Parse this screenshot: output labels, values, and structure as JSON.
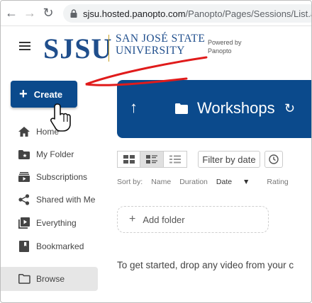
{
  "browser": {
    "url_host": "sjsu.hosted.panopto.com",
    "url_path": "/Panopto/Pages/Sessions/List.aspx#fold"
  },
  "header": {
    "logo_abbrev": "SJSU",
    "logo_line1": "SAN JOSÉ STATE",
    "logo_line2": "UNIVERSITY",
    "powered_line1": "Powered by",
    "powered_line2": "Panopto"
  },
  "sidebar": {
    "create_label": "Create",
    "items": [
      {
        "label": "Home",
        "icon": "home-icon"
      },
      {
        "label": "My Folder",
        "icon": "my-folder-icon"
      },
      {
        "label": "Subscriptions",
        "icon": "subscriptions-icon"
      },
      {
        "label": "Shared with Me",
        "icon": "share-icon"
      },
      {
        "label": "Everything",
        "icon": "everything-icon"
      },
      {
        "label": "Bookmarked",
        "icon": "bookmark-icon"
      },
      {
        "label": "Browse",
        "icon": "browse-folder-icon"
      }
    ]
  },
  "main": {
    "folder_title": "Workshops",
    "filter_label": "Filter by date",
    "sort": {
      "prefix": "Sort by:",
      "name": "Name",
      "duration": "Duration",
      "date": "Date",
      "rating": "Rating"
    },
    "add_folder_label": "Add folder",
    "hint_text": "To get started, drop any video from your c"
  },
  "colors": {
    "brand_blue": "#0b4a8c",
    "annotation_red": "#e01b1b"
  }
}
